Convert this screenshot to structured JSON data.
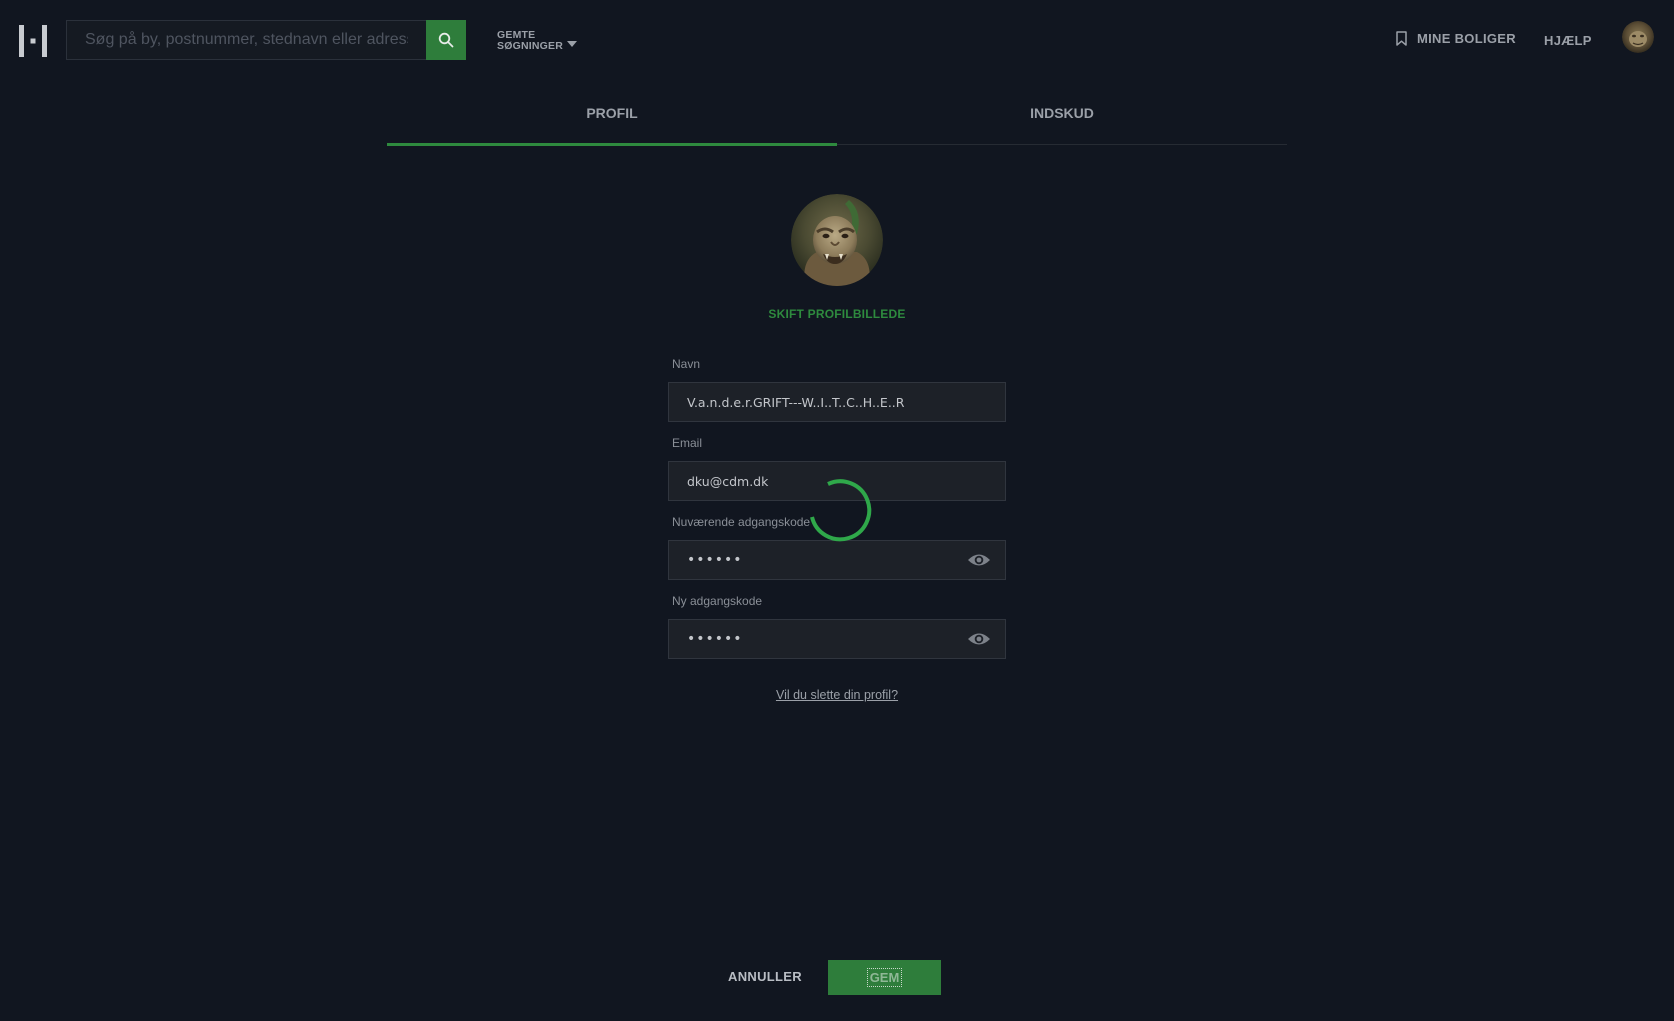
{
  "header": {
    "search_placeholder": "Søg på by, postnummer, stednavn eller adresse",
    "saved_searches_line1": "GEMTE",
    "saved_searches_line2": "SØGNINGER",
    "my_homes": "MINE BOLIGER",
    "help": "HJÆLP"
  },
  "tabs": [
    {
      "label": "PROFIL",
      "active": true
    },
    {
      "label": "INDSKUD",
      "active": false
    }
  ],
  "profile": {
    "change_photo": "SKIFT PROFILBILLEDE",
    "fields": {
      "name": {
        "label": "Navn",
        "value": "V.a.n.d.e.r.GRIFT---W..I..T..C..H..E..R"
      },
      "email": {
        "label": "Email",
        "value": "dku@cdm.dk"
      },
      "current_password": {
        "label": "Nuværende adgangskode",
        "value": "••••••"
      },
      "new_password": {
        "label": "Ny adgangskode",
        "value": "••••••"
      }
    },
    "delete_link": "Vil du slette din profil?"
  },
  "actions": {
    "cancel": "ANNULLER",
    "save": "GEM"
  },
  "colors": {
    "background": "#111620",
    "accent_green": "#2e7d3b",
    "tab_indicator": "#2e8a3e",
    "spinner": "#2fa84a"
  },
  "icons": {
    "logo": "boligsiden-logo-icon",
    "search": "search-icon",
    "dropdown": "chevron-down-icon",
    "bookmark": "bookmark-icon",
    "eye": "eye-icon",
    "spinner": "loading-spinner-icon"
  }
}
